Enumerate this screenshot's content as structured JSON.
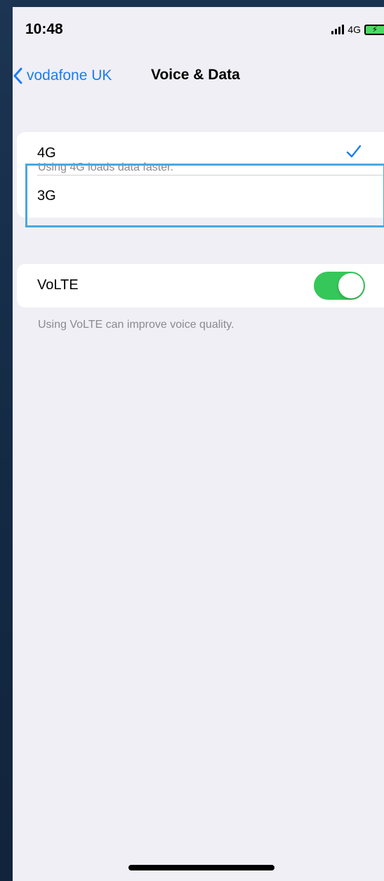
{
  "status_bar": {
    "time": "10:48",
    "network": "4G",
    "signal_icon": "signal-bars-icon",
    "battery_icon": "battery-charging-icon",
    "battery_color": "#4cd964"
  },
  "nav": {
    "back_label": "vodafone UK",
    "title": "Voice & Data",
    "accent_color": "#1a7cf5"
  },
  "network_options": {
    "options": [
      {
        "label": "4G",
        "selected": true
      },
      {
        "label": "3G",
        "selected": false
      }
    ],
    "footnote": "Using 4G loads data faster."
  },
  "volte": {
    "label": "VoLTE",
    "enabled": true,
    "toggle_color": "#35c759",
    "footnote": "Using VoLTE can improve voice quality."
  },
  "highlight_color": "#4aa8e0"
}
